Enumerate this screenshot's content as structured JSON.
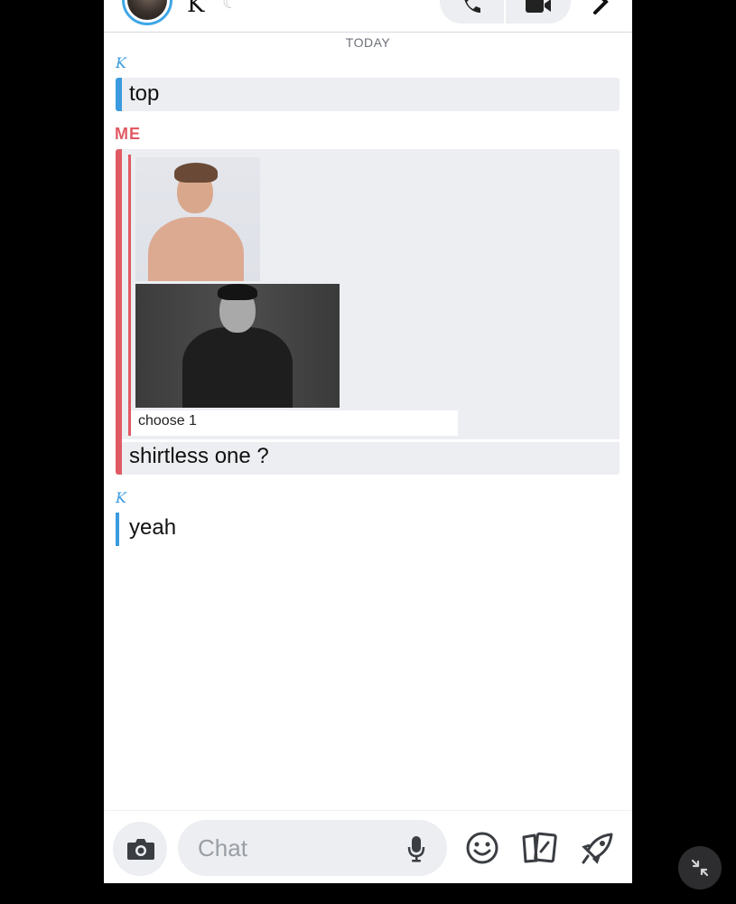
{
  "header": {
    "contact_name": "K",
    "status_icon": "moon-icon",
    "call_icon": "phone-icon",
    "video_icon": "video-icon",
    "more_icon": "chevron-right-icon"
  },
  "conversation": {
    "date_label": "TODAY",
    "messages": [
      {
        "sender": "K",
        "text": "top"
      },
      {
        "sender": "ME",
        "attachment_caption": "choose 1",
        "text": "shirtless one ?"
      },
      {
        "sender": "K",
        "text": "yeah"
      }
    ]
  },
  "input_bar": {
    "placeholder": "Chat",
    "camera_icon": "camera-icon",
    "mic_icon": "microphone-icon",
    "emoji_icon": "smiley-icon",
    "cards_icon": "cards-icon",
    "games_icon": "rocket-icon"
  },
  "colors": {
    "friend_accent": "#3a9be0",
    "me_accent": "#e05a64",
    "bubble_bg": "#eceef1"
  }
}
